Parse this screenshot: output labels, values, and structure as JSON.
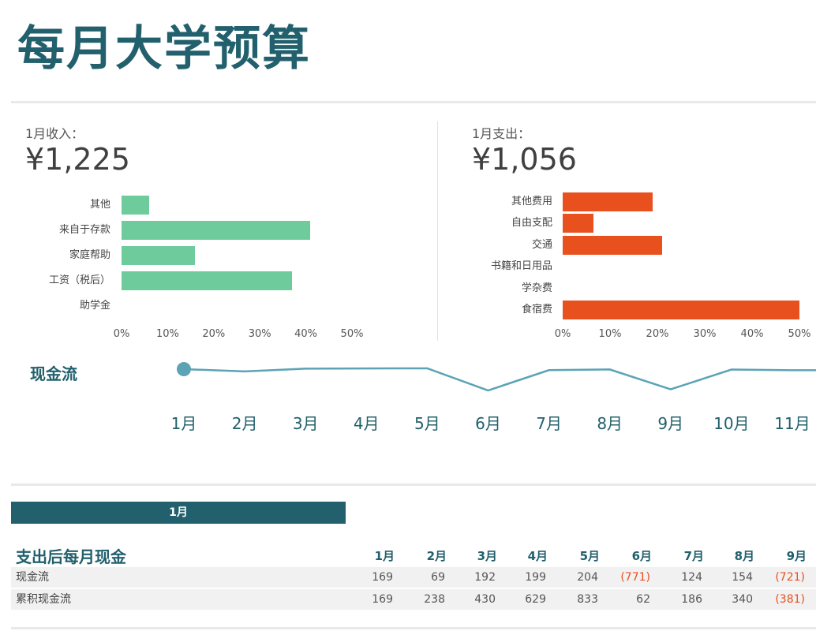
{
  "title": "每月大学预算",
  "income": {
    "label": "1月收入：",
    "value": "¥1,225",
    "color": "#6ecb9b",
    "chart_data": {
      "type": "bar",
      "orientation": "horizontal",
      "categories": [
        "其他",
        "来自于存款",
        "家庭帮助",
        "工资（税后）",
        "助学金"
      ],
      "values": [
        6,
        41,
        16,
        37,
        0
      ],
      "xlim": [
        0,
        50
      ],
      "tick_labels": [
        "0%",
        "10%",
        "20%",
        "30%",
        "40%",
        "50%"
      ]
    }
  },
  "expense": {
    "label": "1月支出：",
    "value": "¥1,056",
    "color": "#e8501e",
    "chart_data": {
      "type": "bar",
      "orientation": "horizontal",
      "categories": [
        "其他费用",
        "自由支配",
        "交通",
        "书籍和日用品",
        "学杂费",
        "食宿费"
      ],
      "values": [
        19,
        6.5,
        21,
        0,
        0,
        50
      ],
      "xlim": [
        0,
        50
      ],
      "tick_labels": [
        "0%",
        "10%",
        "20%",
        "30%",
        "40%",
        "50%"
      ]
    }
  },
  "cashflow": {
    "title": "现金流",
    "line_color": "#5ba3b5",
    "chart_data": {
      "type": "line",
      "categories": [
        "1月",
        "2月",
        "3月",
        "4月",
        "5月",
        "6月",
        "7月",
        "8月",
        "9月",
        "10月",
        "11月"
      ],
      "values": [
        169,
        69,
        192,
        199,
        204,
        -771,
        124,
        154,
        -721,
        150,
        120
      ]
    }
  },
  "selector": {
    "label": "1月"
  },
  "table": {
    "title": "支出后每月现金",
    "headers": [
      "1月",
      "2月",
      "3月",
      "4月",
      "5月",
      "6月",
      "7月",
      "8月",
      "9月"
    ],
    "rows": [
      {
        "label": "现金流",
        "values": [
          "169",
          "69",
          "192",
          "199",
          "204",
          "(771)",
          "124",
          "154",
          "(721)"
        ]
      },
      {
        "label": "累积现金流",
        "values": [
          "169",
          "238",
          "430",
          "629",
          "833",
          "62",
          "186",
          "340",
          "(381)"
        ]
      }
    ]
  }
}
